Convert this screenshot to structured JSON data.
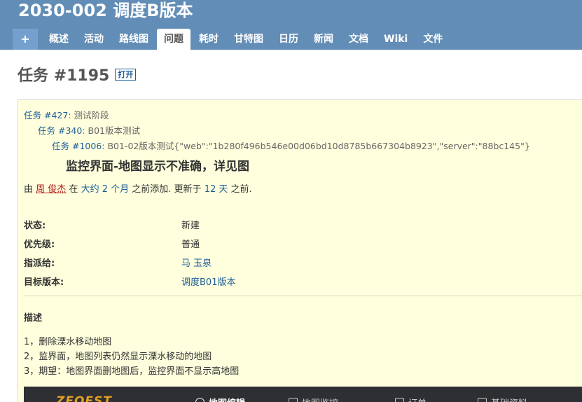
{
  "project": {
    "title": "2030-002 调度B版本"
  },
  "tabs": {
    "new": "+",
    "items": [
      "概述",
      "活动",
      "路线图",
      "问题",
      "耗时",
      "甘特图",
      "日历",
      "新闻",
      "文档",
      "Wiki",
      "文件"
    ],
    "selected_index": 3
  },
  "issue": {
    "title": "任务 #1195",
    "status_badge": "打开",
    "parents": [
      {
        "id": "任务 #427",
        "name": ": 测试阶段"
      },
      {
        "id": "任务 #340",
        "name": ": B01版本测试"
      },
      {
        "id": "任务 #1006",
        "name": ": B01-02版本测试{\"web\":\"1b280f496b546e00d06bd10d8785b667304b8923\",\"server\":\"88bc145\"}"
      }
    ],
    "subject": "监控界面-地图显示不准确，详见图",
    "author_prefix": "由",
    "author": "周 俊杰",
    "in": "在",
    "created": "大约 2 个月",
    "created_suffix": "之前添加. 更新于",
    "updated": "12 天",
    "updated_suffix": "之前.",
    "attributes": [
      {
        "label": "状态:",
        "value": "新建",
        "link": false
      },
      {
        "label": "优先级:",
        "value": "普通",
        "link": false
      },
      {
        "label": "指派给:",
        "value": "马 玉泉",
        "link": true
      },
      {
        "label": "目标版本:",
        "value": "调度B01版本",
        "link": true
      }
    ],
    "description_title": "描述",
    "description": [
      "1，删除溧水移动地图",
      "2，监界面，地图列表仍然显示溧水移动的地图",
      "3，期望：地图界面删地图后，监控界面不显示高地图"
    ]
  },
  "embedded_screenshot": {
    "logo": "ZEQEST",
    "items": [
      "地图编辑",
      "地图监控",
      "订单",
      "基础资料"
    ]
  }
}
